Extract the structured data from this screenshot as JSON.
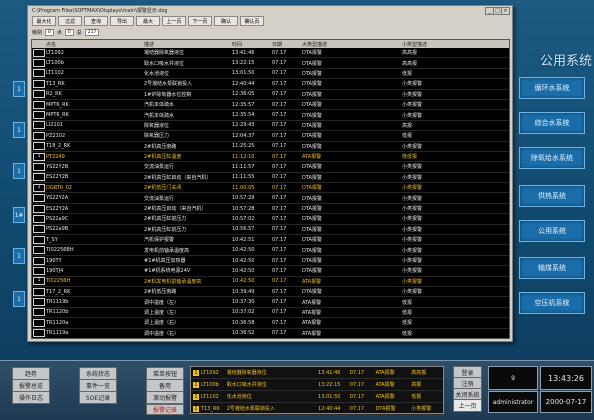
{
  "background": {
    "title": "公用系统",
    "systems": [
      "循环水系统",
      "综合水系统",
      "除氧给水系统",
      "供热系统",
      "公用系统",
      "输煤系统",
      "空压机系统"
    ],
    "left_labels": [
      "1",
      "1",
      "1",
      "1#",
      "1",
      "1",
      "1"
    ]
  },
  "window": {
    "title": "C:\\Program Files\\SOFTMAX\\Displays\\main\\报警显示.dsg",
    "toolbar": [
      "最大化",
      "过滤",
      "查询",
      "导出",
      "最大",
      "上一页",
      "下一页",
      "确认",
      "确认页"
    ],
    "filter": {
      "label1": "级别",
      "v1": "0",
      "label2": "点",
      "v2": "0",
      "label3": "总",
      "v3": "217"
    },
    "columns": [
      "",
      "点名",
      "描述",
      "时间",
      "日期",
      "大类型描述",
      "小类型描述"
    ],
    "rows": [
      {
        "ack": "",
        "tag": "LT1092",
        "desc": "凝结器除氧器液位",
        "time": "13:41:46",
        "date": "07.17",
        "cls": "DTA报警",
        "sub": "高高报",
        "alarm": false
      },
      {
        "ack": "",
        "tag": "LT100b",
        "desc": "取水口吸水井液位",
        "time": "13:22:15",
        "date": "07.17",
        "cls": "DTA报警",
        "sub": "高高报",
        "alarm": false
      },
      {
        "ack": "",
        "tag": "LT1102",
        "desc": "化水池液位",
        "time": "13:01:50",
        "date": "07.17",
        "cls": "DTA报警",
        "sub": "低报",
        "alarm": false
      },
      {
        "ack": "",
        "tag": "T13_RK",
        "desc": "2号凝结水泵联锁投入",
        "time": "12:40:44",
        "date": "07.17",
        "cls": "DTA报警",
        "sub": "小类报警",
        "alarm": false
      },
      {
        "ack": "",
        "tag": "R2_RK",
        "desc": "1#炉除氧器水位控制",
        "time": "12:36:05",
        "date": "07.17",
        "cls": "DTA报警",
        "sub": "小类报警",
        "alarm": false
      },
      {
        "ack": "",
        "tag": "MPT6_RK",
        "desc": "汽机本体疏水",
        "time": "12:35:57",
        "date": "07.17",
        "cls": "DTA报警",
        "sub": "小类报警",
        "alarm": false
      },
      {
        "ack": "",
        "tag": "MPT6_RK",
        "desc": "汽机本体疏水",
        "time": "12:35:54",
        "date": "07.17",
        "cls": "DTA报警",
        "sub": "小类报警",
        "alarm": false
      },
      {
        "ack": "",
        "tag": "LI2101",
        "desc": "除氧器液位",
        "time": "12:29:43",
        "date": "07.17",
        "cls": "DTA报警",
        "sub": "高报",
        "alarm": false
      },
      {
        "ack": "",
        "tag": "PZ2102",
        "desc": "除氧器压力",
        "time": "12:04:37",
        "date": "07.17",
        "cls": "DTA报警",
        "sub": "低报",
        "alarm": false
      },
      {
        "ack": "",
        "tag": "T18_2_RK",
        "desc": "2#机高压旁路",
        "time": "11:25:25",
        "date": "07.17",
        "cls": "DTA报警",
        "sub": "小类报警",
        "alarm": false
      },
      {
        "ack": "1",
        "tag": "PT2249",
        "desc": "2#机高压缸温度",
        "time": "11:12:10",
        "date": "07.17",
        "cls": "ATA报警",
        "sub": "低低报",
        "alarm": true
      },
      {
        "ack": "",
        "tag": "YS22Y2B",
        "desc": "交流油泵运行",
        "time": "11:11:57",
        "date": "07.17",
        "cls": "DTA报警",
        "sub": "小类报警",
        "alarm": false
      },
      {
        "ack": "",
        "tag": "ES22Y2B",
        "desc": "2#机高压缸启动（来自汽机）",
        "time": "11:11:55",
        "date": "07.17",
        "cls": "DTA报警",
        "sub": "小类报警",
        "alarm": false
      },
      {
        "ack": "1",
        "tag": "DGRT0_02",
        "desc": "2#机低压门关闭",
        "time": "11:00:05",
        "date": "07.17",
        "cls": "DTA报警",
        "sub": "小类报警",
        "alarm": true
      },
      {
        "ack": "",
        "tag": "YS22Y2A",
        "desc": "交流油泵运行",
        "time": "10:57:29",
        "date": "07.17",
        "cls": "DTA报警",
        "sub": "小类报警",
        "alarm": false
      },
      {
        "ack": "",
        "tag": "ES22Y2A",
        "desc": "2#机高压启动（来自汽机）",
        "time": "10:57:28",
        "date": "07.17",
        "cls": "DTA报警",
        "sub": "小类报警",
        "alarm": false
      },
      {
        "ack": "",
        "tag": "PS22a9C",
        "desc": "2#机高压缸前压力",
        "time": "10:57:02",
        "date": "07.17",
        "cls": "DTA报警",
        "sub": "小类报警",
        "alarm": false
      },
      {
        "ack": "",
        "tag": "PS22a9B",
        "desc": "2#机高压缸前压力",
        "time": "10:56:57",
        "date": "07.17",
        "cls": "DTA报警",
        "sub": "小类报警",
        "alarm": false
      },
      {
        "ack": "",
        "tag": "T_SY",
        "desc": "汽机保护报警",
        "time": "10:42:51",
        "date": "07.17",
        "cls": "DTA报警",
        "sub": "小类报警",
        "alarm": false
      },
      {
        "ack": "",
        "tag": "TI02256BH",
        "desc": "发电机前轴承温度高",
        "time": "10:42:50",
        "date": "07.17",
        "cls": "DTA报警",
        "sub": "小类报警",
        "alarm": false
      },
      {
        "ack": "",
        "tag": "190TY",
        "desc": "#1#机高压加热器",
        "time": "10:42:50",
        "date": "07.17",
        "cls": "DTA报警",
        "sub": "小类报警",
        "alarm": false
      },
      {
        "ack": "",
        "tag": "190TJ4",
        "desc": "#1#机系统电源24V",
        "time": "10:42:50",
        "date": "07.17",
        "cls": "DTA报警",
        "sub": "小类报警",
        "alarm": false
      },
      {
        "ack": "1",
        "tag": "TI02256H",
        "desc": "2#机发电机前轴承温度高",
        "time": "10:42:50",
        "date": "07.17",
        "cls": "ATA报警",
        "sub": "小类报警",
        "alarm": true
      },
      {
        "ack": "",
        "tag": "T17_2_RK",
        "desc": "2#机低压旁路",
        "time": "10:39:49",
        "date": "07.17",
        "cls": "DTA报警",
        "sub": "小类报警",
        "alarm": false
      },
      {
        "ack": "",
        "tag": "TR1119b",
        "desc": "调中温度（左）",
        "time": "10:37:30",
        "date": "07.17",
        "cls": "ATA报警",
        "sub": "低报",
        "alarm": false
      },
      {
        "ack": "",
        "tag": "TR1120b",
        "desc": "调上温度（左）",
        "time": "10:37:02",
        "date": "07.17",
        "cls": "ATA报警",
        "sub": "低报",
        "alarm": false
      },
      {
        "ack": "",
        "tag": "TR1120a",
        "desc": "调上温度（右）",
        "time": "10:36:58",
        "date": "07.17",
        "cls": "ATA报警",
        "sub": "低报",
        "alarm": false
      },
      {
        "ack": "",
        "tag": "TR1119a",
        "desc": "调中温度（右）",
        "time": "10:36:52",
        "date": "07.17",
        "cls": "ATA报警",
        "sub": "低报",
        "alarm": false
      },
      {
        "ack": "",
        "tag": "YS22Y2C",
        "desc": "直流润滑油泵运行",
        "time": "10:33:30",
        "date": "07.17",
        "cls": "DTA报警",
        "sub": "小类报警",
        "alarm": false
      },
      {
        "ack": "",
        "tag": "ES22Y2C",
        "desc": "2#机直流润滑油泵（来自）",
        "time": "10:33:32",
        "date": "07.17",
        "cls": "DTA报警",
        "sub": "小类报警",
        "alarm": false
      }
    ]
  },
  "bottom": {
    "buttons": [
      [
        "趋势",
        "系统状态",
        "菜单按钮"
      ],
      [
        "报警总览",
        "事件一览",
        "备用"
      ],
      [
        "操作日志",
        "SOE记录",
        "滚动报警"
      ]
    ],
    "red_button": "报警记录",
    "alarms": [
      {
        "n": "1",
        "tag": "LT1092",
        "desc": "凝结器除氧器液位",
        "time": "13:41:46",
        "date": "07.17",
        "cls": "ATA报警",
        "sub": "高高报"
      },
      {
        "n": "1",
        "tag": "LT100b",
        "desc": "取水口吸水井液位",
        "time": "13:22:15",
        "date": "07.17",
        "cls": "ATA报警",
        "sub": "高报"
      },
      {
        "n": "1",
        "tag": "LT1102",
        "desc": "化水池液位",
        "time": "13:01:50",
        "date": "07.17",
        "cls": "ATA报警",
        "sub": "低报"
      },
      {
        "n": "1",
        "tag": "T13_RK",
        "desc": "2号凝结水泵联锁投入",
        "time": "12:40:44",
        "date": "07.17",
        "cls": "DTA报警",
        "sub": "小类报警"
      }
    ],
    "right_buttons": [
      "登录",
      "注销",
      "关闭系统",
      "上一页"
    ],
    "count": "9",
    "user": "administrator",
    "time": "13:43:26",
    "date": "2000-07-17"
  }
}
